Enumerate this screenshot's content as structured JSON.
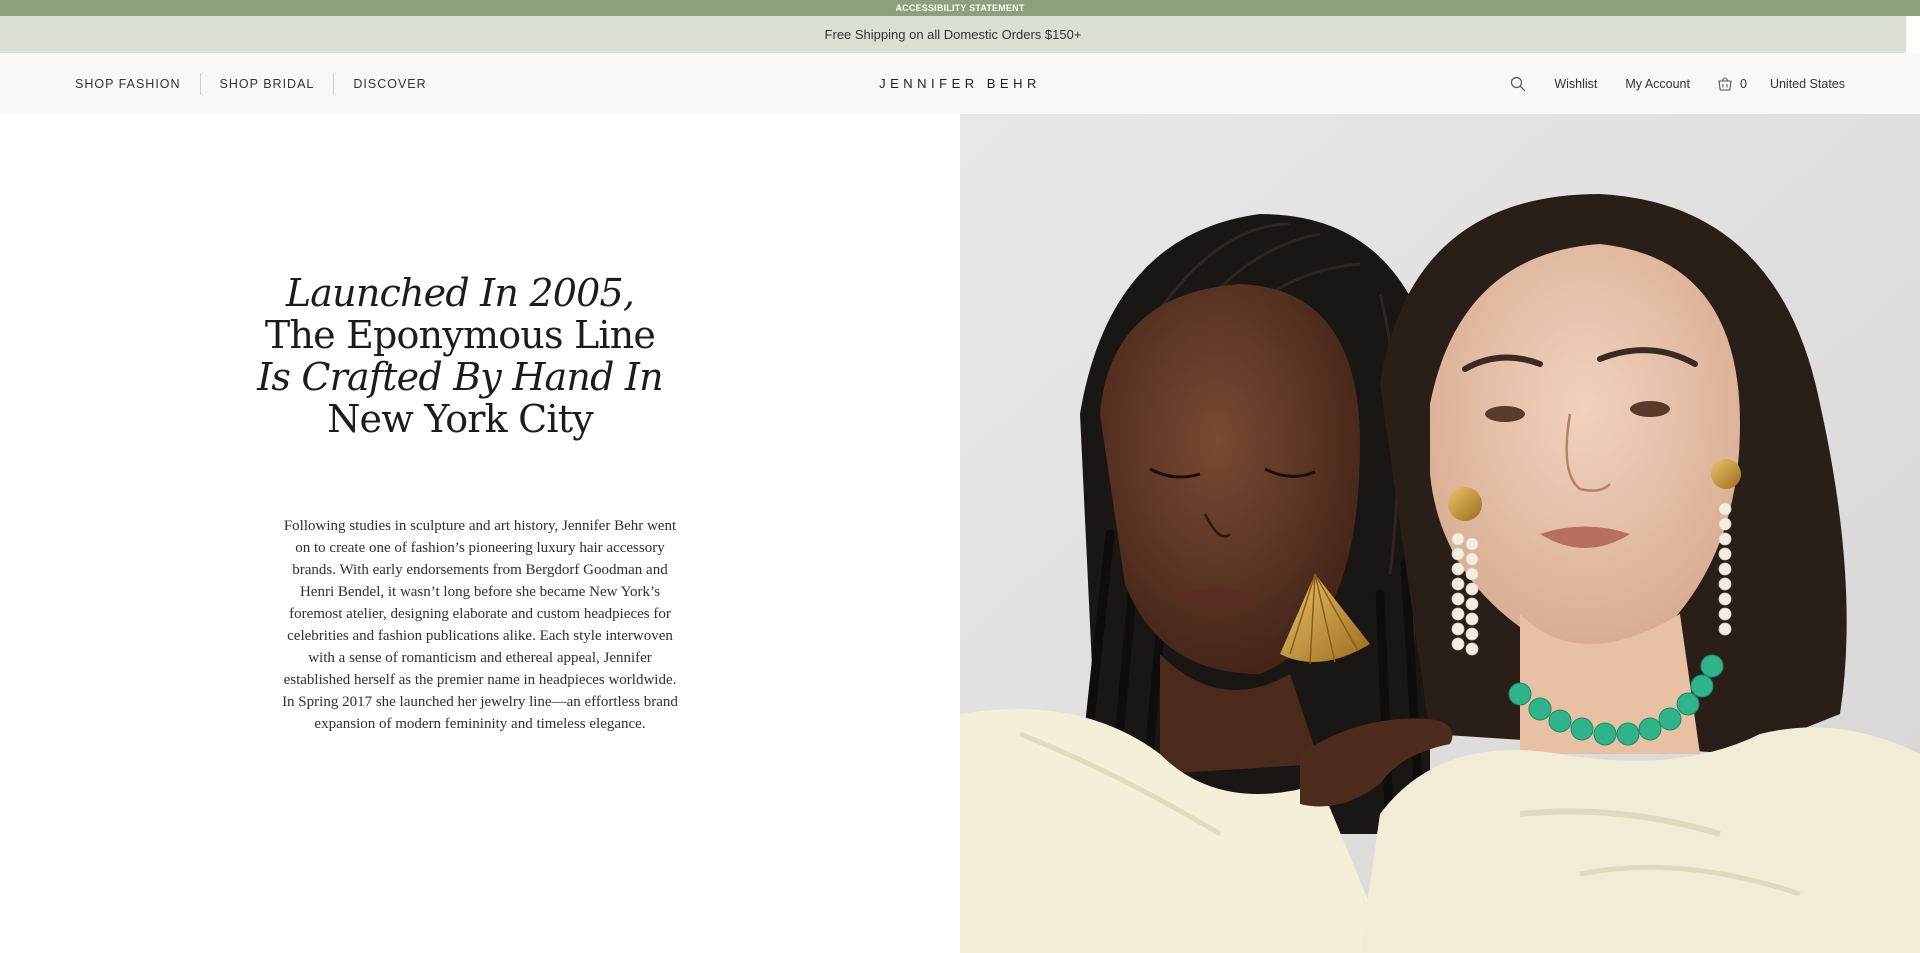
{
  "access_bar": {
    "label": "ACCESSIBILITY STATEMENT"
  },
  "promo": {
    "text": "Free Shipping on all Domestic Orders $150+"
  },
  "nav": {
    "items": [
      {
        "label": "SHOP FASHION"
      },
      {
        "label": "SHOP BRIDAL"
      },
      {
        "label": "DISCOVER"
      }
    ]
  },
  "logo": {
    "text": "JENNIFER BEHR"
  },
  "utility": {
    "search_icon": "search-icon",
    "wishlist_label": "Wishlist",
    "account_label": "My Account",
    "cart_icon": "basket-icon",
    "cart_count": "0",
    "region_label": "United States"
  },
  "hero": {
    "headline_lines": [
      "Launched In 2005,",
      "The Eponymous Line",
      "Is Crafted By Hand In",
      "New York City"
    ],
    "body": "Following studies in sculpture and art history, Jennifer Behr went on to create one of fashion’s pioneering luxury hair accessory brands. With early endorsements from Bergdorf Goodman and Henri Bendel, it wasn’t long before she became New York’s foremost atelier, designing elaborate and custom headpieces for celebrities and fashion publications alike. Each style interwoven with a sense of romanticism and ethereal appeal, Jennifer established herself as the premier name in headpieces worldwide. In Spring 2017 she launched her jewelry line—an effortless brand expansion of modern femininity and timeless elegance."
  },
  "colors": {
    "access_bar": "#8ca07c",
    "promo_bar": "#dbe0d4",
    "header_bg": "#f9f8f6",
    "photo_bg": "#e3e2e1"
  }
}
